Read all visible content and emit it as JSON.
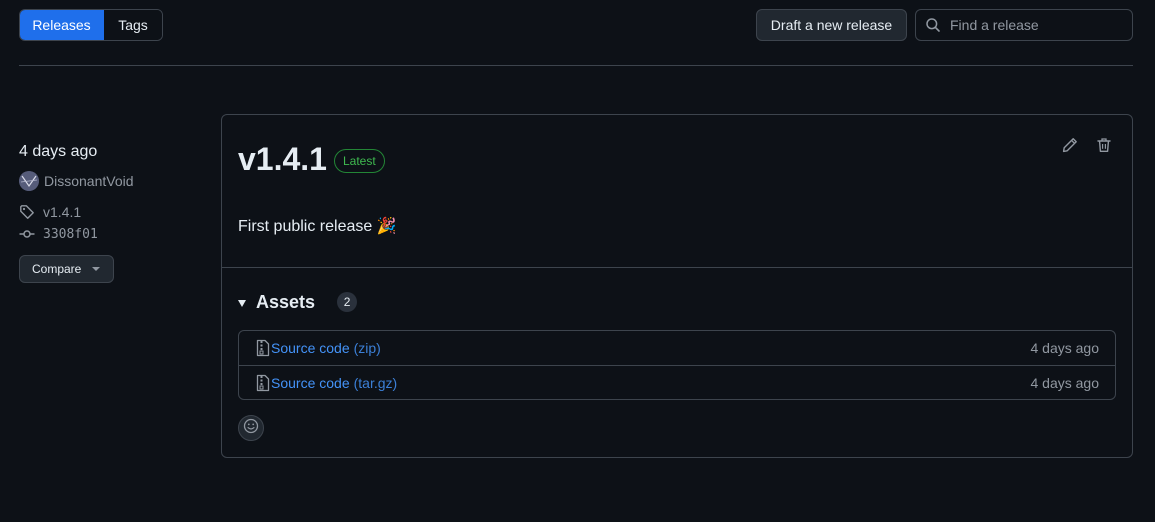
{
  "nav": {
    "tabs": [
      {
        "label": "Releases",
        "active": true
      },
      {
        "label": "Tags",
        "active": false
      }
    ],
    "draft_label": "Draft a new release",
    "search_placeholder": "Find a release"
  },
  "sidebar": {
    "date": "4 days ago",
    "author": "DissonantVoid",
    "tag": "v1.4.1",
    "commit": "3308f01",
    "compare_label": "Compare"
  },
  "release": {
    "version": "v1.4.1",
    "badge": "Latest",
    "notes": "First public release 🎉",
    "assets_title": "Assets",
    "assets_count": "2",
    "assets": [
      {
        "name": "Source code",
        "ext": "(zip)",
        "when": "4 days ago"
      },
      {
        "name": "Source code",
        "ext": "(tar.gz)",
        "when": "4 days ago"
      }
    ]
  },
  "colors": {
    "background": "#0d1117",
    "accent": "#1f6feb",
    "link": "#4493f8",
    "success": "#3fb950",
    "border": "#3d444d",
    "muted": "#9198a1"
  },
  "icons": [
    "search-icon",
    "tag-icon",
    "commit-icon",
    "pencil-icon",
    "trash-icon",
    "file-zip-icon",
    "smiley-icon",
    "triangle-down-icon"
  ]
}
